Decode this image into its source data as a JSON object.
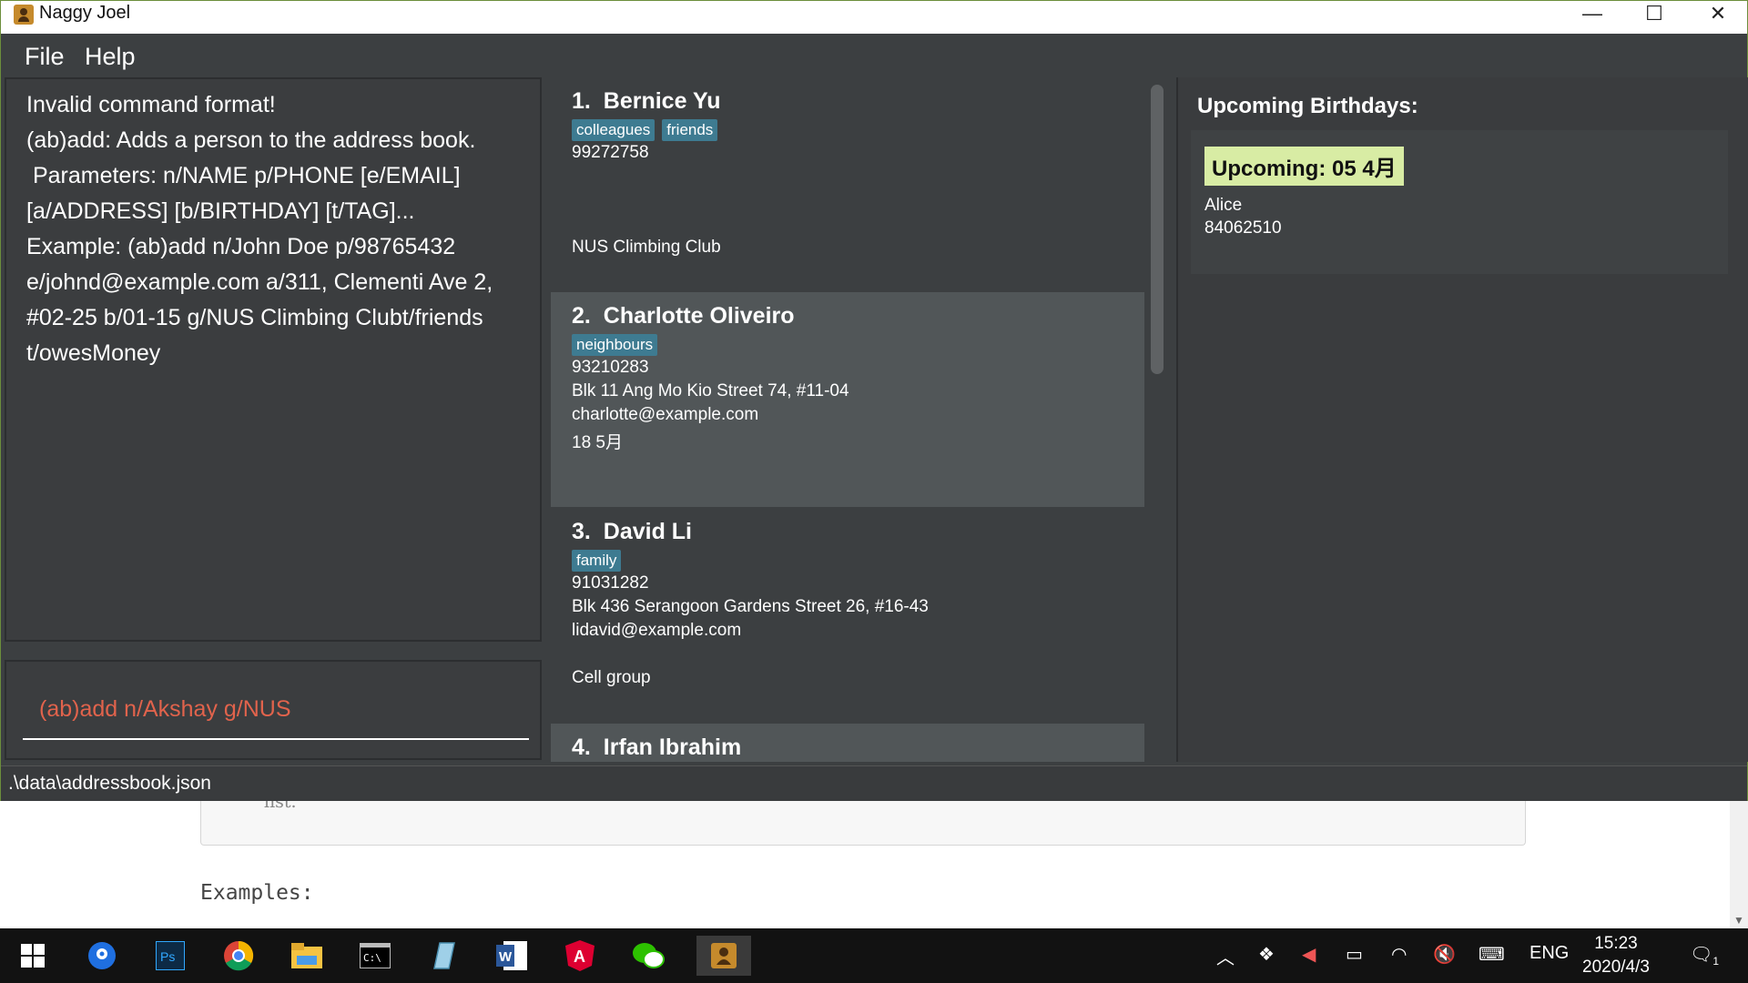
{
  "window": {
    "title": "Naggy Joel"
  },
  "menu": {
    "file": "File",
    "help": "Help"
  },
  "result": {
    "lines": [
      "Invalid command format!",
      "(ab)add: Adds a person to the address book.",
      " Parameters: n/NAME p/PHONE [e/EMAIL]",
      "[a/ADDRESS] [b/BIRTHDAY] [t/TAG]...",
      "Example: (ab)add n/John Doe p/98765432",
      "e/johnd@example.com a/311, Clementi Ave 2,",
      "#02-25 b/01-15 g/NUS Climbing Clubt/friends",
      "t/owesMoney"
    ]
  },
  "command": {
    "text": "(ab)add n/Akshay g/NUS"
  },
  "persons": [
    {
      "index": "1.",
      "name": "Bernice Yu",
      "tags": [
        "colleagues",
        "friends"
      ],
      "phone": "99272758",
      "address": "",
      "email": "",
      "birthday": "",
      "group": "NUS Climbing Club"
    },
    {
      "index": "2.",
      "name": "Charlotte Oliveiro",
      "tags": [
        "neighbours"
      ],
      "phone": "93210283",
      "address": "Blk 11 Ang Mo Kio Street 74, #11-04",
      "email": "charlotte@example.com",
      "birthday": "18 5月",
      "group": ""
    },
    {
      "index": "3.",
      "name": "David Li",
      "tags": [
        "family"
      ],
      "phone": "91031282",
      "address": "Blk 436 Serangoon Gardens Street 26, #16-43",
      "email": "lidavid@example.com",
      "birthday": "",
      "group": "Cell group"
    },
    {
      "index": "4.",
      "name": "Irfan Ibrahim",
      "tags": [],
      "phone": "",
      "address": "",
      "email": "",
      "birthday": "",
      "group": ""
    }
  ],
  "birthdays": {
    "title": "Upcoming Birthdays:",
    "badge": "Upcoming: 05 4月",
    "name": "Alice",
    "phone": "84062510"
  },
  "status": {
    "path": ".\\data\\addressbook.json"
  },
  "background_doc": {
    "snippet": "list.",
    "examples": "Examples:"
  },
  "taskbar": {
    "lang": "ENG",
    "time": "15:23",
    "date": "2020/4/3",
    "notif_count": "1"
  },
  "colors": {
    "tag": "#3e7b91",
    "badge": "#d8eca4",
    "command": "#e1634c",
    "selected_card": "#515658"
  }
}
